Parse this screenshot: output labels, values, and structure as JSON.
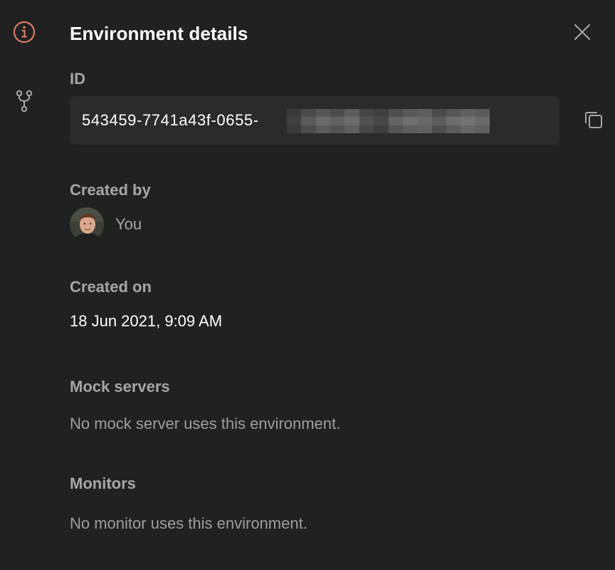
{
  "rail": {
    "icons": [
      "info-icon",
      "fork-icon"
    ],
    "accent_color": "#e8836b"
  },
  "header": {
    "title": "Environment details",
    "close_icon": "close-icon"
  },
  "id_section": {
    "label": "ID",
    "value_visible": "543459-7741a43f-0655-",
    "redacted": true,
    "copy_icon": "copy-icon"
  },
  "created_by": {
    "label": "Created by",
    "name": "You",
    "avatar_icon": "avatar"
  },
  "created_on": {
    "label": "Created on",
    "value": "18 Jun 2021, 9:09 AM"
  },
  "mock_servers": {
    "label": "Mock servers",
    "empty_text": "No mock server uses this environment."
  },
  "monitors": {
    "label": "Monitors",
    "empty_text": "No monitor uses this environment."
  }
}
